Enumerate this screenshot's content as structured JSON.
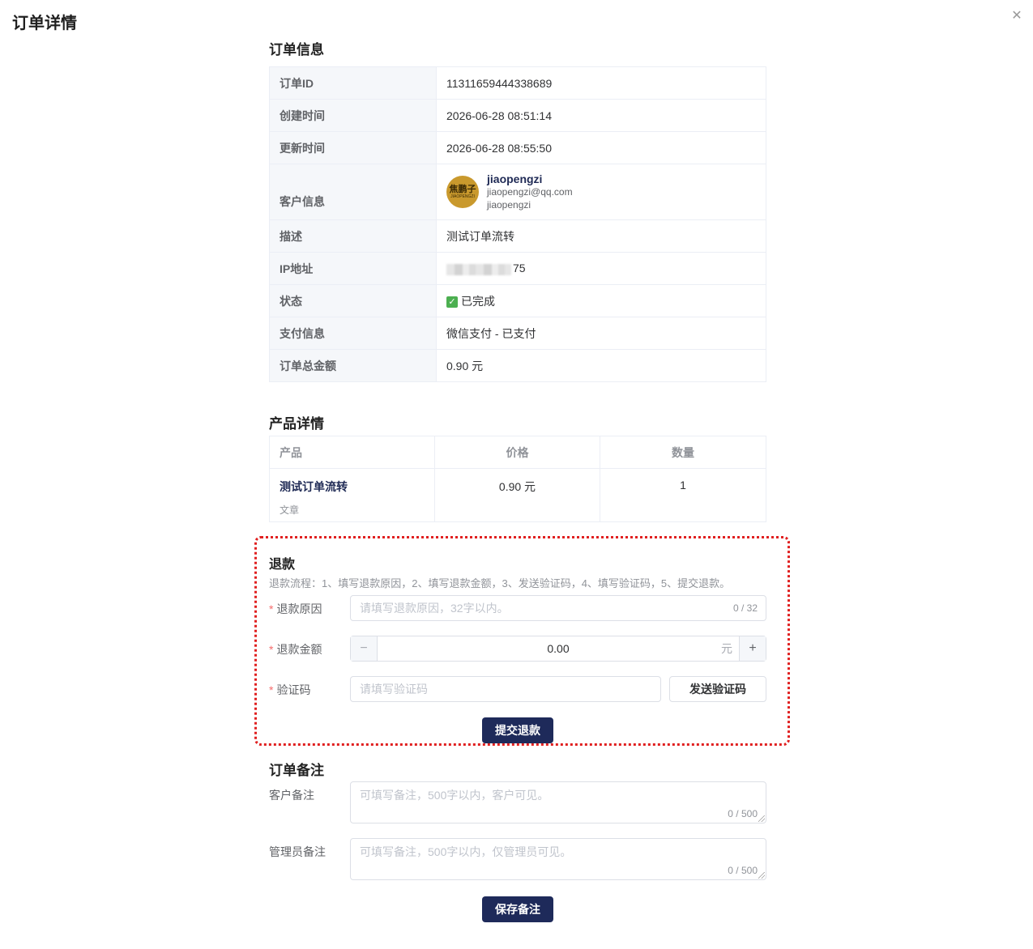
{
  "dialog": {
    "title": "订单详情",
    "close_icon": "close-icon"
  },
  "order_info": {
    "section_title": "订单信息",
    "rows": [
      {
        "label": "订单ID",
        "value": "11311659444338689"
      },
      {
        "label": "创建时间",
        "value": "2026-06-28 08:51:14"
      },
      {
        "label": "更新时间",
        "value": "2026-06-28 08:55:50"
      },
      {
        "label": "客户信息"
      },
      {
        "label": "描述",
        "value": "测试订单流转"
      },
      {
        "label": "IP地址",
        "value": "75"
      },
      {
        "label": "状态",
        "value": "已完成"
      },
      {
        "label": "支付信息",
        "value": "微信支付 - 已支付"
      },
      {
        "label": "订单总金额",
        "value": "0.90 元"
      }
    ],
    "customer": {
      "avatar_text": "焦鹏子",
      "avatar_subtext": "JIAOPENGZI",
      "name": "jiaopengzi",
      "email": "jiaopengzi@qq.com",
      "username": "jiaopengzi"
    }
  },
  "products": {
    "section_title": "产品详情",
    "headers": [
      "产品",
      "价格",
      "数量"
    ],
    "rows": [
      {
        "name": "测试订单流转",
        "type": "文章",
        "price": "0.90 元",
        "quantity": "1"
      }
    ]
  },
  "refund": {
    "title": "退款",
    "description": "退款流程：1、填写退款原因，2、填写退款金额，3、发送验证码，4、填写验证码，5、提交退款。",
    "required_mark": "*",
    "reason_label": "退款原因",
    "reason_placeholder": "请填写退款原因，32字以内。",
    "reason_counter": "0 / 32",
    "amount_label": "退款金额",
    "amount_value": "0.00",
    "amount_unit": "元",
    "minus": "−",
    "plus": "+",
    "code_label": "验证码",
    "code_placeholder": "请填写验证码",
    "send_code_button": "发送验证码",
    "submit_button": "提交退款",
    "highlight_color": "#e02020"
  },
  "notes": {
    "section_title": "订单备注",
    "customer_label": "客户备注",
    "customer_placeholder": "可填写备注，500字以内，客户可见。",
    "customer_counter": "0 / 500",
    "admin_label": "管理员备注",
    "admin_placeholder": "可填写备注，500字以内，仅管理员可见。",
    "admin_counter": "0 / 500",
    "save_button": "保存备注"
  },
  "colors": {
    "primary": "#1e2a5a",
    "required": "#f56c6c",
    "status_ok": "#4caf50"
  }
}
